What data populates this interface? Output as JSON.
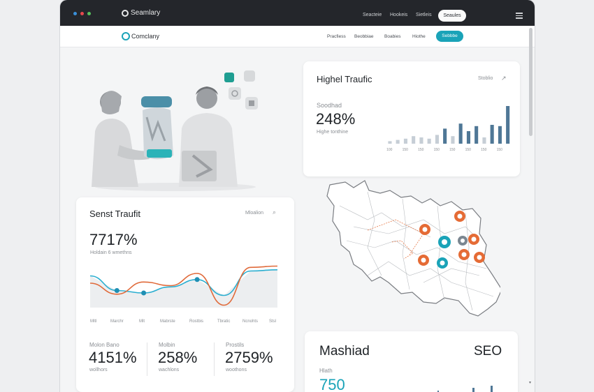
{
  "os_bar": {
    "logo_text": "Seamlary",
    "nav": [
      "Seacteie",
      "Hookeis",
      "Sietleis"
    ],
    "pill": "Seaules",
    "window_dots": [
      "#3a8fd9",
      "#e5484d",
      "#55c25c"
    ]
  },
  "site_bar": {
    "logo_text": "Comclany",
    "nav": [
      "Pracfiess",
      "Beobbiae",
      "Boabies",
      "Hiothe"
    ],
    "pill": "Sebbbe",
    "accent": "#1aa3b8"
  },
  "traffic_card": {
    "title": "Highel Traufic",
    "action": "Stoblio",
    "action_icon": "external-link-icon",
    "label": "Soodhad",
    "value": "248%",
    "sub": "Highe tonthine",
    "bar_ticks": [
      "100",
      "130",
      "150",
      "100",
      "150",
      "100",
      "150",
      "150",
      "150",
      "150",
      "150",
      "150",
      "150",
      "150",
      "150",
      "100"
    ]
  },
  "chart_data": [
    {
      "type": "bar",
      "title": "Highel Traufic",
      "categories": [
        "100",
        "130",
        "150",
        "100",
        "150",
        "100",
        "150",
        "150",
        "150",
        "150",
        "150",
        "150",
        "150",
        "150",
        "150",
        "100"
      ],
      "series": [
        {
          "values": [
            1,
            1.5,
            2,
            3,
            2.5,
            2,
            3.5,
            6,
            3,
            8,
            5,
            7,
            2.5,
            7.5,
            7,
            15
          ]
        }
      ],
      "colors": [
        "#c6ced6",
        "#4f7796"
      ]
    },
    {
      "type": "line",
      "title": "Senst Traufit",
      "x": [
        "Mltl",
        "Marchr",
        "Mlt",
        "Mabrste",
        "Rostbis",
        "Tbratic",
        "Ncnohts",
        "Stsl"
      ],
      "series": [
        {
          "values": [
            26,
            14,
            12,
            17,
            23,
            10,
            30,
            31
          ],
          "color": "#2aaed0"
        },
        {
          "values": [
            20,
            11,
            21,
            18,
            28,
            2,
            33,
            34
          ],
          "color": "#e06a3a"
        }
      ],
      "ylim": [
        0,
        40
      ]
    }
  ],
  "senst_card": {
    "title": "Senst Traufit",
    "search_label": "Mloalion",
    "search_icon": "search-icon",
    "value": "7717%",
    "sub": "Holdain 6 wmethns",
    "x_labels": [
      "Mltl",
      "Marchr",
      "Mlt",
      "Mabrste",
      "Rostbis",
      "Tbratic",
      "Ncnohts",
      "Stsl"
    ],
    "stats": [
      {
        "label": "Molon Bano",
        "value": "4151%",
        "sub": "wollhors"
      },
      {
        "label": "Molbin",
        "value": "258%",
        "sub": "wachlons"
      },
      {
        "label": "Prostils",
        "value": "2759%",
        "sub": "woothons"
      }
    ]
  },
  "mashiad_card": {
    "title": "Mashiad",
    "tag": "SEO",
    "label": "Hlath",
    "value": "750"
  },
  "colors": {
    "teal": "#1aa3b8",
    "orange": "#e56b35",
    "navy": "#4f7796"
  }
}
